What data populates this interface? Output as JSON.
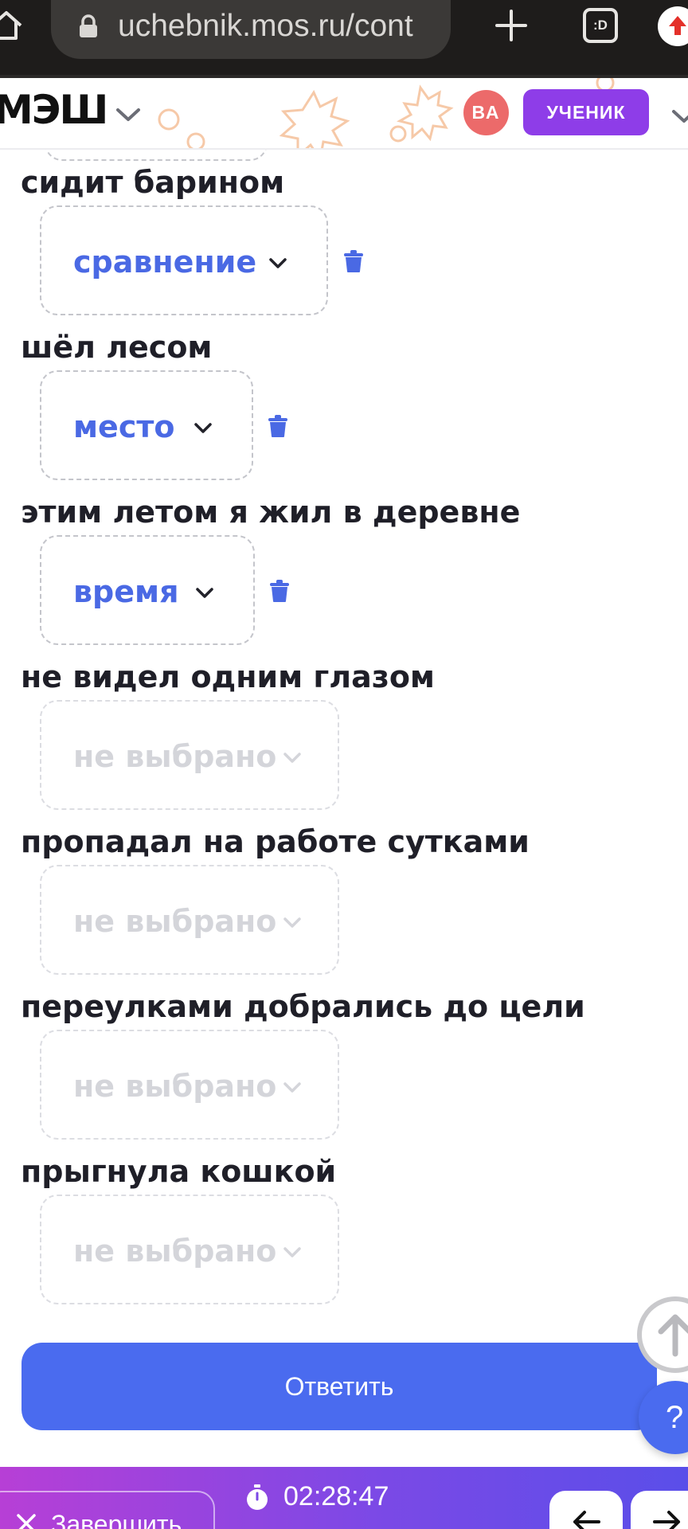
{
  "browser": {
    "url": "uchebnik.mos.ru/cont",
    "tabs_label": ":D",
    "icons": [
      "home-icon",
      "lock-icon",
      "plus-icon",
      "tabs-icon",
      "update-icon"
    ]
  },
  "header": {
    "logo": "МЭШ",
    "avatar_initials": "ВА",
    "role": "УЧЕНИК",
    "avatar_color": "#ec6a6a",
    "role_color": "#8e3de8"
  },
  "items": [
    {
      "phrase": "сидит барином",
      "value": "сравнение",
      "state": "filled"
    },
    {
      "phrase": "шёл лесом",
      "value": "место",
      "state": "filled"
    },
    {
      "phrase": "этим летом я жил в деревне",
      "value": "время",
      "state": "filled"
    },
    {
      "phrase": "не видел одним глазом",
      "value": "не выбрано",
      "state": "empty"
    },
    {
      "phrase": "пропадал на работе сутками",
      "value": "не выбрано",
      "state": "empty"
    },
    {
      "phrase": "переулками добрались до цели",
      "value": "не выбрано",
      "state": "empty"
    },
    {
      "phrase": "прыгнула кошкой",
      "value": "не выбрано",
      "state": "empty"
    }
  ],
  "submit_label": "Ответить",
  "help_label": "?",
  "footer": {
    "finish_label": "Завершить",
    "timer": "02:28:47"
  },
  "colors": {
    "accent": "#4a6bef",
    "selected_text": "#4a69e4",
    "placeholder_text": "#d4d5da"
  }
}
